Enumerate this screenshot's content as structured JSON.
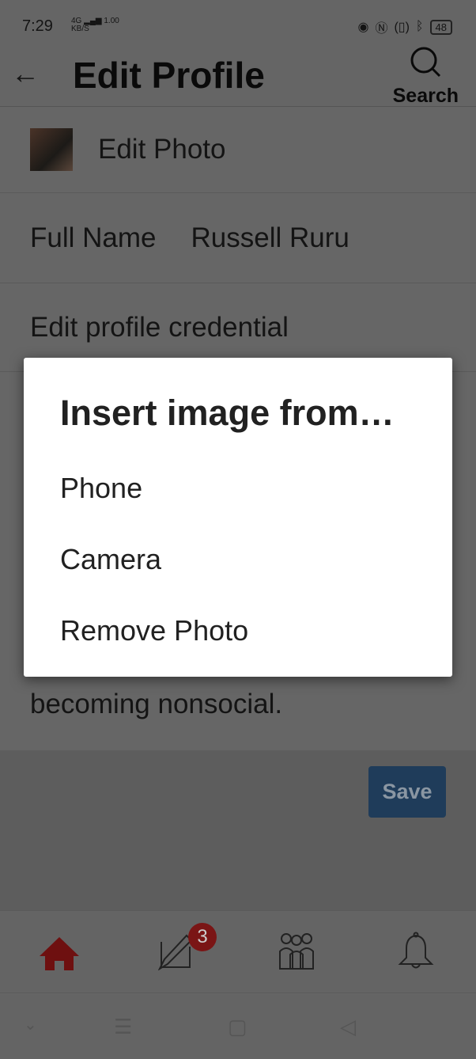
{
  "status_bar": {
    "time": "7:29",
    "network": "4G",
    "speed": "1.00",
    "speed_unit": "KB/S",
    "battery": "48"
  },
  "header": {
    "title": "Edit Profile",
    "search_label": "Search"
  },
  "profile": {
    "edit_photo": "Edit Photo",
    "full_name_label": "Full Name",
    "full_name_value": "Russell Ruru",
    "credential_label": "Edit profile credential",
    "bio_visible": "becoming nonsocial."
  },
  "save_label": "Save",
  "bottom_nav": {
    "items": [
      "home-icon",
      "compose-icon",
      "people-icon",
      "bell-icon"
    ],
    "compose_badge": "3",
    "active_color": "#b71c1c"
  },
  "dialog": {
    "title": "Insert image from…",
    "options": [
      "Phone",
      "Camera",
      "Remove Photo"
    ]
  },
  "colors": {
    "save": "#3a75b0",
    "badge": "#c62828"
  }
}
